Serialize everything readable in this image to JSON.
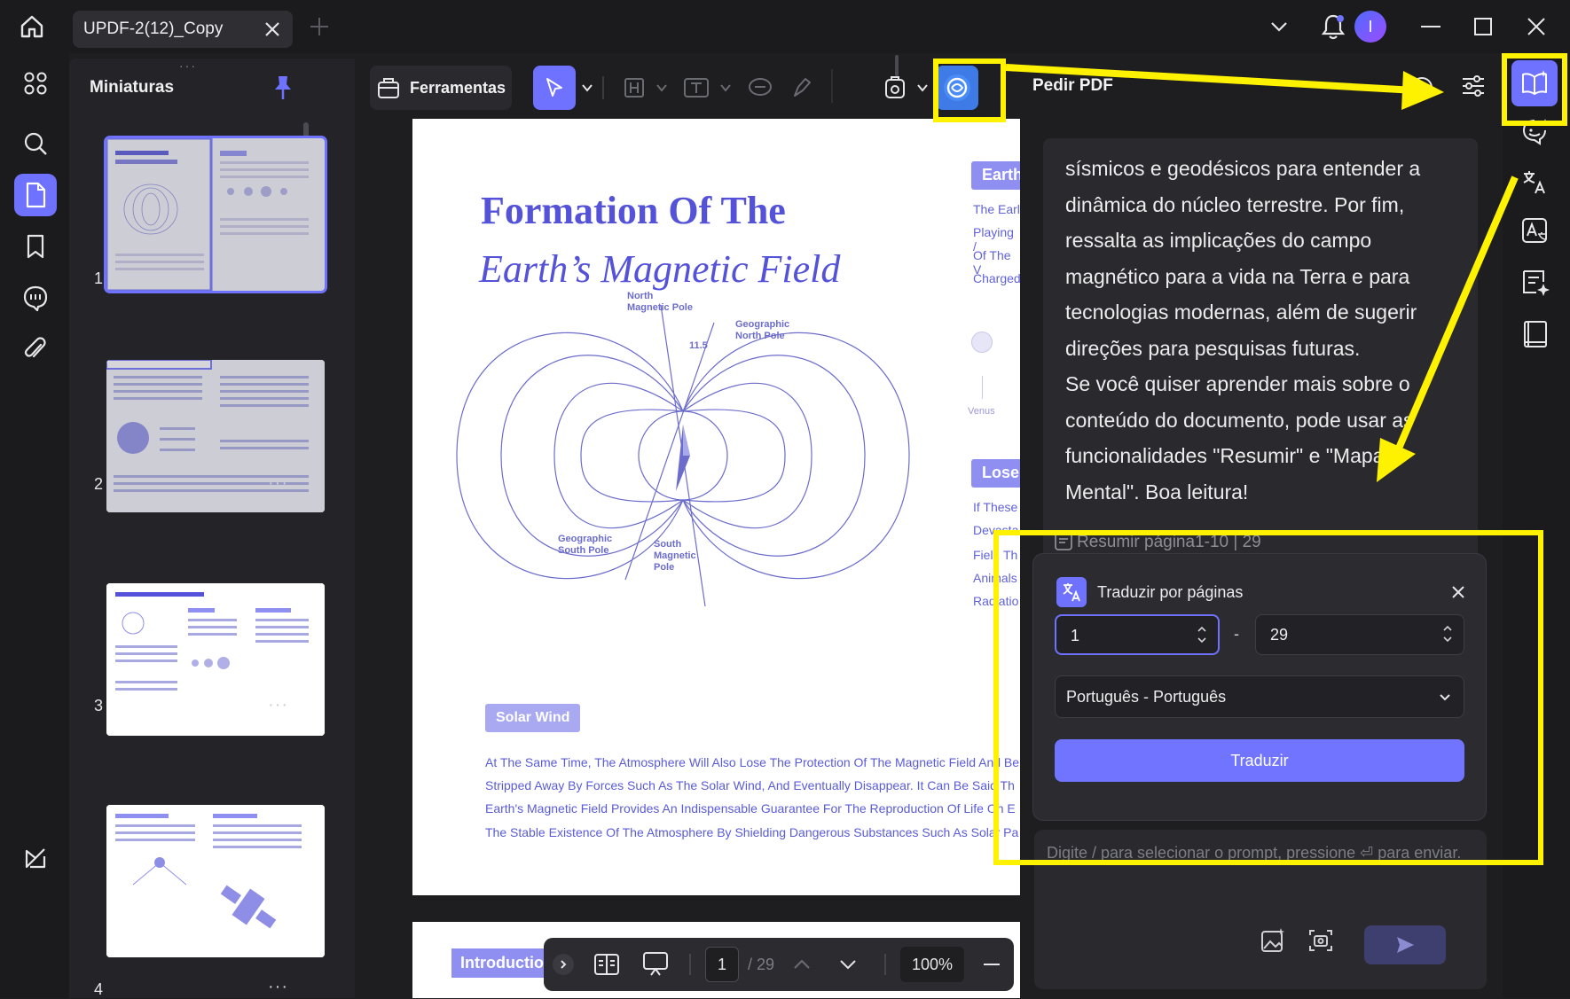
{
  "window": {
    "tab_title": "UPDF-2(12)_Copy",
    "avatar_initial": "I"
  },
  "thumbnails": {
    "title": "Miniaturas",
    "pages": [
      {
        "num": "1",
        "more": "···"
      },
      {
        "num": "2",
        "more": "···"
      },
      {
        "num": "3",
        "more": "···"
      },
      {
        "num": "4",
        "more": "···"
      }
    ]
  },
  "toolbar": {
    "tools_label": "Ferramentas"
  },
  "document": {
    "title_line1": "Formation Of The",
    "title_line2": "Earth’s Magnetic Field",
    "side_heading_1": "Earth",
    "side_lines_1": [
      "The Earl",
      "Playing /",
      "Of The V",
      "Charged"
    ],
    "side_heading_2": "Lose",
    "side_lines_2": [
      "If These",
      "Devasta",
      "Fiel , Th",
      "Animals",
      "Radiatio"
    ],
    "venus_label": "Venus",
    "diagram_labels": {
      "north_magnetic_pole": "North\nMagnetic Pole",
      "geographic_north_pole": "Geographic\nNorth Pole",
      "angle": "11.5",
      "geographic_south_pole": "Geographic\nSouth Pole",
      "south_magnetic_pole": "South\nMagnetic\nPole"
    },
    "solar_wind_heading": "Solar Wind",
    "body_lines": [
      "At The Same Time, The Atmosphere Will Also Lose The Protection Of The Magnetic Field And Be",
      "Stripped Away By Forces Such As The Solar Wind, And Eventually Disappear. It Can Be Said Th",
      "Earth's Magnetic Field Provides An Indispensable Guarantee For The Reproduction Of Life On E",
      "The Stable Existence Of The Atmosphere By Shielding Dangerous Substances Such As Solar Pa"
    ],
    "next_page_heading": "Introductio"
  },
  "bottom_nav": {
    "current_page": "1",
    "total_pages": "/ 29",
    "zoom": "100%"
  },
  "ai_panel": {
    "title": "Pedir PDF",
    "answer_text": "sísmicos e geodésicos para entender a dinâmica do núcleo terrestre. Por fim, ressalta as implicações do campo magnético para a vida na Terra e para tecnologias modernas, além de sugerir direções para pesquisas futuras.\nSe você quiser aprender mais sobre o conteúdo do documento, pode usar as funcionalidades \"Resumir\" e \"Mapa Mental\". Boa leitura!",
    "resumir_label": "Resumir página1-10 | 29",
    "translate": {
      "title": "Traduzir por páginas",
      "from_page": "1",
      "dash": "-",
      "to_page": "29",
      "language": "Português - Português",
      "button": "Traduzir"
    },
    "prompt_placeholder": "Digite / para selecionar o prompt, pressione ⏎ para enviar."
  },
  "colors": {
    "accent": "#6e72ff",
    "highlight": "#fff200",
    "doc_blue": "#5352d9"
  }
}
